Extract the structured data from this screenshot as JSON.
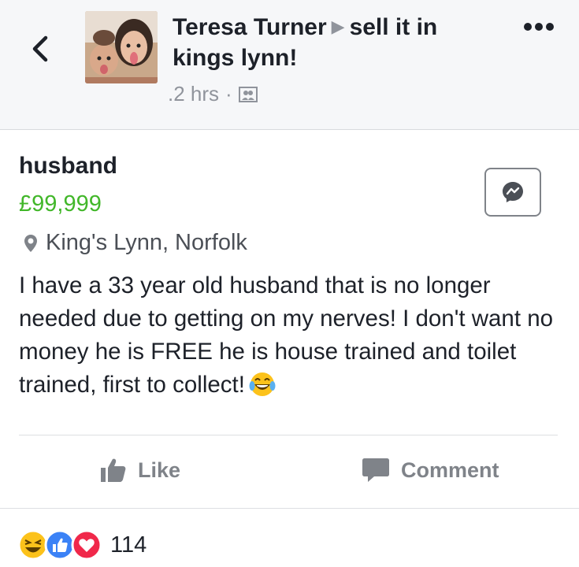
{
  "header": {
    "author": "Teresa Turner",
    "group": "sell it in kings lynn!",
    "time": ".2 hrs",
    "separator": "·",
    "back_icon": "chevron-left-icon",
    "more_icon": "more-dots-icon",
    "audience_icon": "group-audience-icon"
  },
  "listing": {
    "title": "husband",
    "price": "£99,999",
    "location": "King's Lynn, Norfolk",
    "description": "I have a 33 year old husband that is no longer needed due to getting on my nerves! I don't want no money he is FREE he is house trained and toilet trained, first to collect!",
    "emoji": "laughing-tears-emoji",
    "price_color": "#42b72a"
  },
  "actions": {
    "like": "Like",
    "comment": "Comment"
  },
  "reactions": {
    "icons": [
      "haha-icon",
      "like-icon",
      "love-icon"
    ],
    "count": "114"
  }
}
